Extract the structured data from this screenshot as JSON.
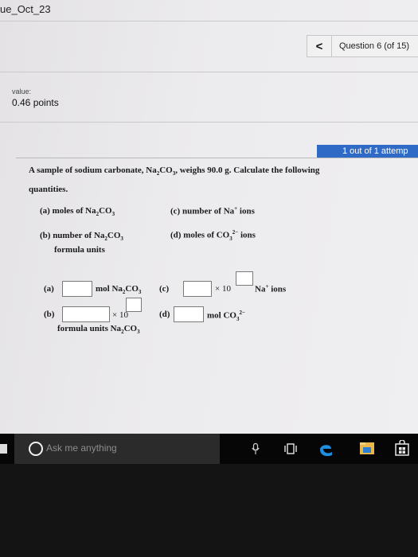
{
  "window": {
    "title": "ue_Oct_23"
  },
  "nav": {
    "prev_label": "<",
    "question_label": "Question 6 (of 15)"
  },
  "score": {
    "caption": "value:",
    "points": "0.46 points"
  },
  "attempt": {
    "label": "1 out of 1 attemp"
  },
  "question": {
    "intro_1a": "A sample of sodium carbonate, Na",
    "intro_1b": "CO",
    "intro_1c": ", weighs 90.0 g. Calculate the following",
    "intro_2": "quantities.",
    "sub2": "2",
    "sub3": "3",
    "charge_2minus": "2−",
    "plus": "+",
    "part_a_1": "(a) moles of Na",
    "part_a_2": "CO",
    "part_b_1": "(b) number of Na",
    "part_b_2": "CO",
    "part_b_3": "formula units",
    "part_c_1": "(c) number of Na",
    "part_c_2": "ions",
    "part_d_1": "(d) moles of CO",
    "part_d_2": "ions"
  },
  "answers": {
    "a_label": "(a)",
    "a_unit_1": "mol Na",
    "a_unit_2": "CO",
    "c_label": "(c)",
    "c_times": "× 10",
    "c_unit_1": "Na",
    "c_unit_2": "ions",
    "b_label": "(b)",
    "b_times": "× 10",
    "b_unit_1": "formula units Na",
    "b_unit_2": "CO",
    "d_label": "(d)",
    "d_unit_1": "mol CO",
    "a_value": "",
    "b_value": "",
    "b_exponent": "",
    "c_value": "",
    "c_exponent": "",
    "d_value": ""
  },
  "taskbar": {
    "search_placeholder": "Ask me anything",
    "icons": [
      "windows-start-icon",
      "search-icon",
      "microphone-icon",
      "task-view-icon",
      "edge-browser-icon",
      "file-explorer-icon",
      "store-icon"
    ]
  },
  "colors": {
    "attempt_bar": "#2f6ac6",
    "taskbar": "#060606",
    "edge": "#1e8fe0"
  }
}
